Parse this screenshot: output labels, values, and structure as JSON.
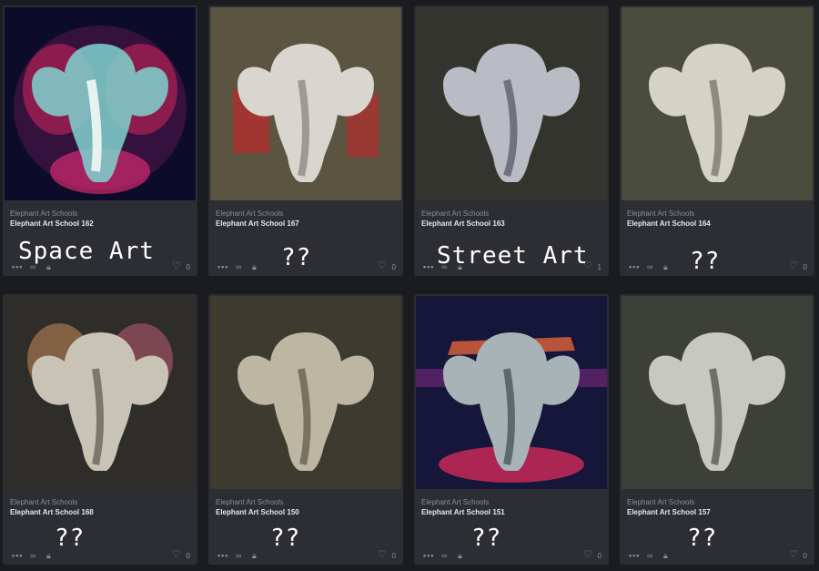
{
  "cards": [
    {
      "collection": "Elephant Art Schools",
      "title": "Elephant Art School 162",
      "likes": "0",
      "overlay": "Space Art"
    },
    {
      "collection": "Elephant Art Schools",
      "title": "Elephant Art School 167",
      "likes": "0",
      "overlay": "??"
    },
    {
      "collection": "Elephant Art Schools",
      "title": "Elephant Art School 163",
      "likes": "1",
      "overlay": "Street Art"
    },
    {
      "collection": "Elephant Art Schools",
      "title": "Elephant Art School 164",
      "likes": "0",
      "overlay": "??"
    },
    {
      "collection": "Elephant Art Schools",
      "title": "Elephant Art School 168",
      "likes": "0",
      "overlay": "??"
    },
    {
      "collection": "Elephant Art Schools",
      "title": "Elephant Art School 150",
      "likes": "0",
      "overlay": "??"
    },
    {
      "collection": "Elephant Art Schools",
      "title": "Elephant Art School 151",
      "likes": "0",
      "overlay": "??"
    },
    {
      "collection": "Elephant Art Schools",
      "title": "Elephant Art School 157",
      "likes": "0",
      "overlay": "??"
    }
  ],
  "icons": {
    "more": "more-dots-icon",
    "link": "link-icon",
    "lock": "lock-icon",
    "like": "heart-icon"
  },
  "colors": {
    "page_bg": "#1b1c20",
    "card_bg": "#2c2e33",
    "text_primary": "#e6e7ea",
    "text_secondary": "#8b8e96"
  }
}
